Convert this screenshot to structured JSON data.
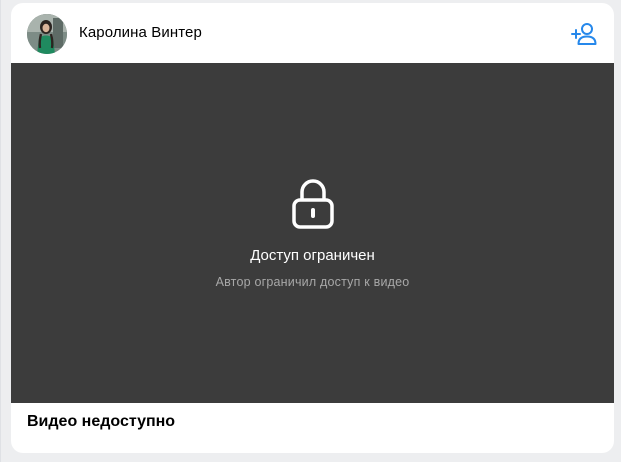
{
  "post": {
    "author_name": "Каролина Винтер",
    "avatar_icon": "avatar-photo",
    "add_friend_icon": "add-user-icon",
    "accent_color": "#2688eb"
  },
  "video": {
    "lock_icon": "lock-icon",
    "status_title": "Доступ ограничен",
    "status_subtitle": "Автор ограничил доступ к видео",
    "background_color": "#3c3c3c"
  },
  "footer": {
    "title": "Видео недоступно"
  }
}
